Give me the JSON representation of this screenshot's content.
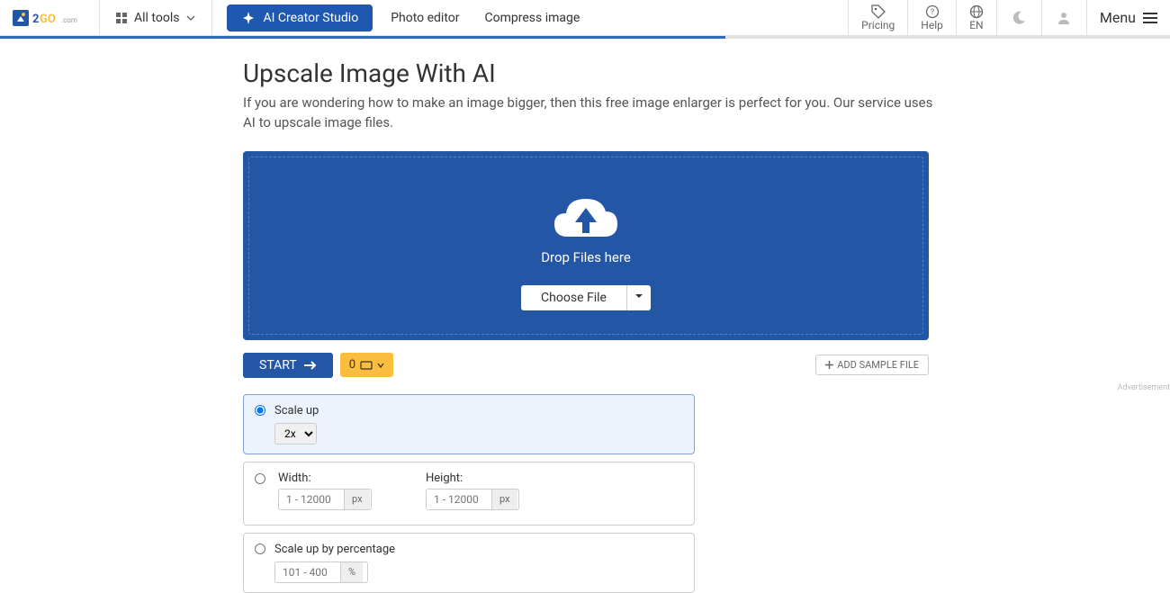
{
  "header": {
    "logo_text": "IMG2GO",
    "all_tools": "All tools",
    "ai_studio": "AI Creator Studio",
    "photo_editor": "Photo editor",
    "compress": "Compress image",
    "pricing": "Pricing",
    "help": "Help",
    "lang": "EN",
    "menu": "Menu"
  },
  "page": {
    "title": "Upscale Image With AI",
    "subtitle": "If you are wondering how to make an image bigger, then this free image enlarger is perfect for you. Our service uses AI to upscale image files."
  },
  "dropzone": {
    "text": "Drop Files here",
    "choose": "Choose File"
  },
  "actions": {
    "start": "START",
    "files_count": "0",
    "add_sample": "ADD SAMPLE FILE",
    "ad_label": "Advertisement"
  },
  "options": {
    "scale_up": {
      "label": "Scale up",
      "selected": "2x"
    },
    "dimensions": {
      "width_label": "Width:",
      "height_label": "Height:",
      "placeholder": "1 - 12000",
      "unit": "px"
    },
    "percentage": {
      "label": "Scale up by percentage",
      "placeholder": "101 - 400",
      "unit": "%"
    }
  }
}
